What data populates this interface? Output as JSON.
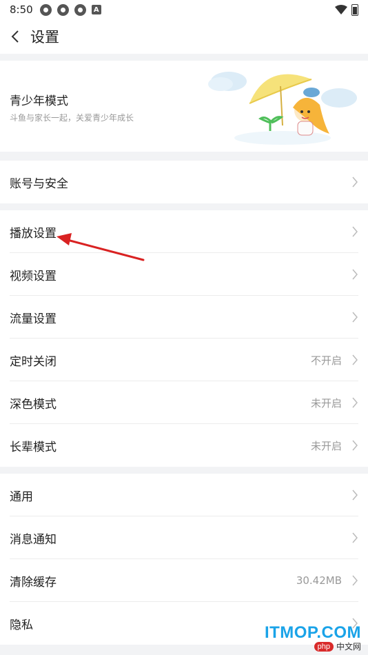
{
  "status_bar": {
    "time": "8:50",
    "icons": [
      "app-icon",
      "app-icon",
      "app-icon",
      "a-icon",
      "wifi-icon",
      "battery-icon"
    ]
  },
  "header": {
    "title": "设置",
    "back_icon": "chevron-left-icon"
  },
  "youth_mode": {
    "title": "青少年模式",
    "subtitle": "斗鱼与家长一起，关爱青少年成长"
  },
  "sections": [
    {
      "items": [
        {
          "label": "账号与安全",
          "value": ""
        }
      ]
    },
    {
      "items": [
        {
          "label": "播放设置",
          "value": ""
        },
        {
          "label": "视频设置",
          "value": ""
        },
        {
          "label": "流量设置",
          "value": ""
        },
        {
          "label": "定时关闭",
          "value": "不开启"
        },
        {
          "label": "深色模式",
          "value": "未开启"
        },
        {
          "label": "长辈模式",
          "value": "未开启"
        }
      ]
    },
    {
      "items": [
        {
          "label": "通用",
          "value": ""
        },
        {
          "label": "消息通知",
          "value": ""
        },
        {
          "label": "清除缓存",
          "value": "30.42MB"
        },
        {
          "label": "隐私",
          "value": ""
        }
      ]
    }
  ],
  "watermark": {
    "text": "ITMOP.COM",
    "badge": "php",
    "cn": "中文网"
  },
  "colors": {
    "annotation_arrow": "#d92222",
    "background": "#f2f3f5",
    "watermark_blue": "#1aa3e8"
  }
}
